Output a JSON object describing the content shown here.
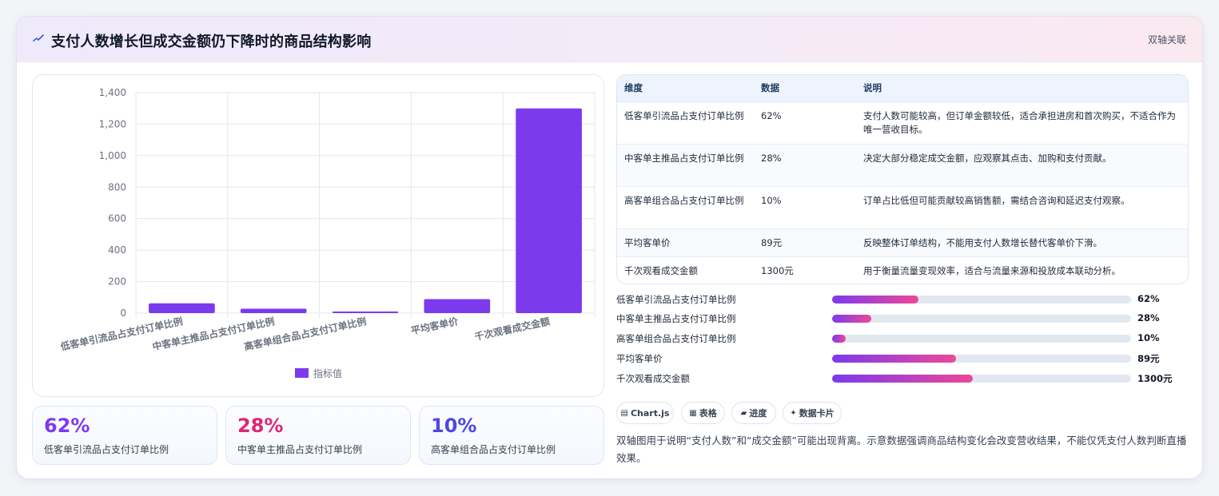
{
  "header": {
    "title": "支付人数增长但成交金额仍下降时的商品结构影响",
    "tag": "双轴关联"
  },
  "chart_data": {
    "type": "bar",
    "categories": [
      "低客单引流品占支付订单比例",
      "中客单主推品占支付订单比例",
      "高客单组合品占支付订单比例",
      "平均客单价",
      "千次观看成交金额"
    ],
    "series": [
      {
        "name": "指标值",
        "values": [
          62,
          28,
          10,
          89,
          1300
        ]
      }
    ],
    "ylim": [
      0,
      1400
    ],
    "yticks": [
      "0",
      "200",
      "400",
      "600",
      "800",
      "1,000",
      "1,200",
      "1,400"
    ],
    "ytick_values": [
      0,
      200,
      400,
      600,
      800,
      1000,
      1200,
      1400
    ],
    "grid": true,
    "legend": "bottom",
    "color": "#7c3aed"
  },
  "kpis": [
    {
      "value": "62%",
      "label": "低客单引流品占支付订单比例",
      "color": "#7c3aed"
    },
    {
      "value": "28%",
      "label": "中客单主推品占支付订单比例",
      "color": "#db2777"
    },
    {
      "value": "10%",
      "label": "高客单组合品占支付订单比例",
      "color": "#4f46e5"
    }
  ],
  "table": {
    "headers": [
      "维度",
      "数据",
      "说明"
    ],
    "rows": [
      [
        "低客单引流品占支付订单比例",
        "62%",
        "支付人数可能较高，但订单金额较低，适合承担进房和首次购买，不适合作为唯一营收目标。"
      ],
      [
        "中客单主推品占支付订单比例",
        "28%",
        "决定大部分稳定成交金额，应观察其点击、加购和支付贡献。"
      ],
      [
        "高客单组合品占支付订单比例",
        "10%",
        "订单占比低但可能贡献较高销售额，需结合咨询和延迟支付观察。"
      ],
      [
        "平均客单价",
        "89元",
        "反映整体订单结构，不能用支付人数增长替代客单价下滑。"
      ],
      [
        "千次观看成交金额",
        "1300元",
        "用于衡量流量变现效率，适合与流量来源和投放成本联动分析。"
      ]
    ]
  },
  "progress": [
    {
      "label": "低客单引流品占支付订单比例",
      "value": "62%",
      "fraction": 0.29
    },
    {
      "label": "中客单主推品占支付订单比例",
      "value": "28%",
      "fraction": 0.13
    },
    {
      "label": "高客单组合品占支付订单比例",
      "value": "10%",
      "fraction": 0.045
    },
    {
      "label": "平均客单价",
      "value": "89元",
      "fraction": 0.415
    },
    {
      "label": "千次观看成交金额",
      "value": "1300元",
      "fraction": 0.47
    }
  ],
  "chips": [
    {
      "icon": "▤",
      "label": "Chart.js"
    },
    {
      "icon": "▦",
      "label": "表格"
    },
    {
      "icon": "▰",
      "label": "进度"
    },
    {
      "icon": "✦",
      "label": "数据卡片"
    }
  ],
  "note": "双轴图用于说明“支付人数”和“成交金额”可能出现背离。示意数据强调商品结构变化会改变营收结果，不能仅凭支付人数判断直播效果。"
}
